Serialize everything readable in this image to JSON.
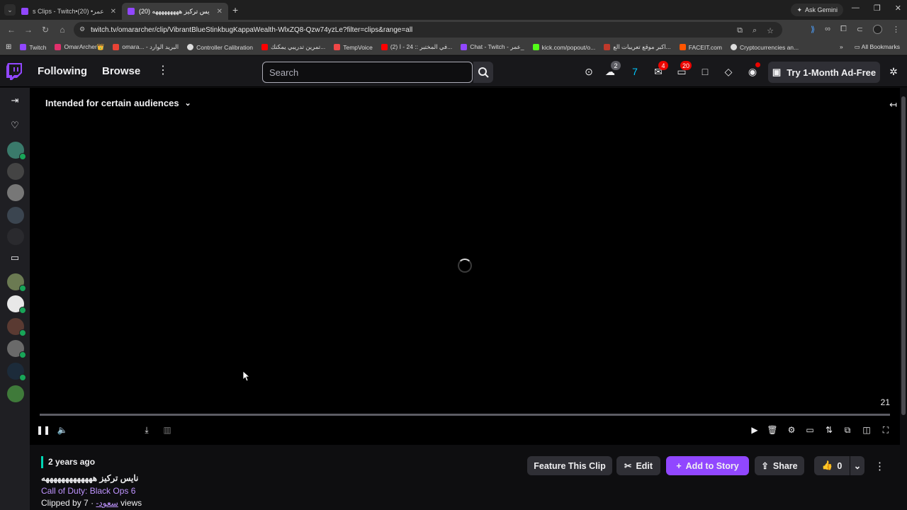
{
  "browser": {
    "tabs": [
      {
        "label": "s Clips - Twitch•عمر• (20)",
        "active": false
      },
      {
        "label": "(20) نايس تركيز هههههههههه",
        "active": true
      }
    ],
    "ask_gemini": "Ask Gemini",
    "url": "twitch.tv/omararcher/clip/VibrantBlueStinkbugKappaWealth-WlxZQ8-Qzw74yzLe?filter=clips&range=all",
    "bookmarks": [
      "Twitch",
      "OmarArcher👑",
      "omara... - البريد الوارد",
      "Controller Calibration",
      "تمرين تدريبي يمكنك...",
      "TempVoice",
      "(2) في المختبر :: 24 - ا...",
      "Chat - Twitch - عمر_",
      "kick.com/popout/o...",
      "اكبر موقع تعريبات الع...",
      "FACEIT.com",
      "Cryptocurrencies an..."
    ],
    "all_bookmarks": "All Bookmarks"
  },
  "topnav": {
    "following": "Following",
    "browse": "Browse",
    "search_placeholder": "Search",
    "badge_1": "2",
    "badge_2": "4",
    "badge_3": "20",
    "ad_free": "Try 1-Month Ad-Free"
  },
  "player": {
    "audience_label": "Intended for certain audiences",
    "time_label": "21"
  },
  "clip": {
    "time_ago": "2 years ago",
    "title": "نايس تركيز هههههههههههههه",
    "game": "Call of Duty: Black Ops 6",
    "clipped_by_prefix": "Clipped by",
    "clipper": "سعود-",
    "views": "· 7 views",
    "feature_btn": "Feature This Clip",
    "edit_btn": "Edit",
    "add_story_btn": "Add to Story",
    "share_btn": "Share",
    "like_count": "0"
  },
  "colors": {
    "twitch_purple": "#9147ff",
    "link_purple": "#bf94ff",
    "notification_red": "#eb0400",
    "live_green": "#18a558",
    "accent_teal": "#00d6b4"
  }
}
